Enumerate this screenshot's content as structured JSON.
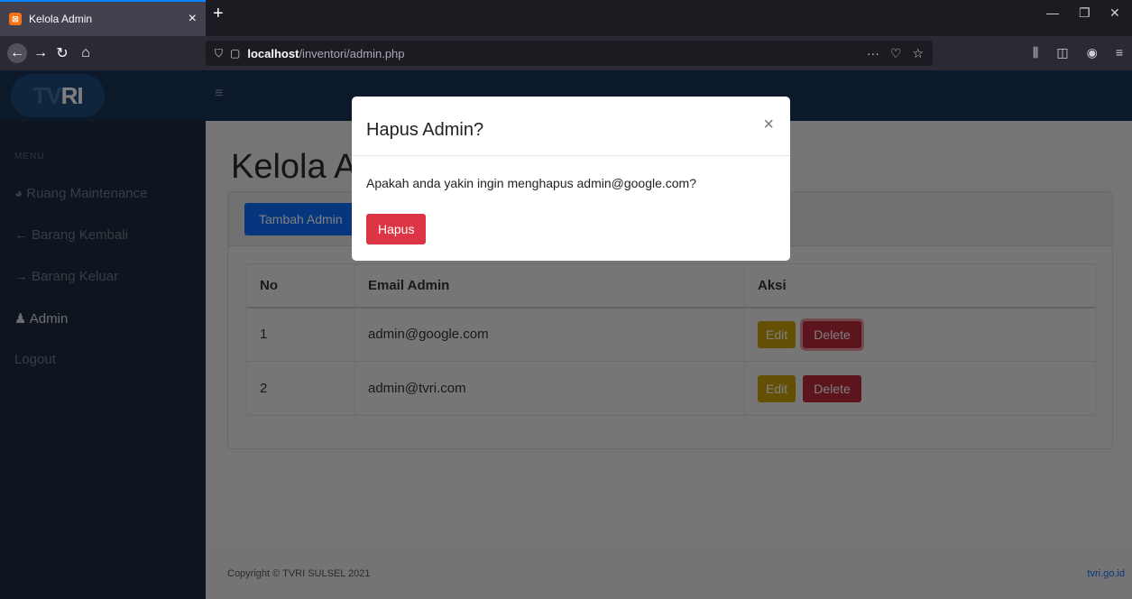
{
  "browser": {
    "tab_title": "Kelola Admin",
    "url_host": "localhost",
    "url_path": "/inventori/admin.php",
    "accent": "#0a84ff"
  },
  "header": {
    "logo_tv": "TV",
    "logo_ri": "RI"
  },
  "sidebar": {
    "heading": "MENU",
    "items": [
      {
        "label": "Ruang Maintenance",
        "icon": "gauge-icon"
      },
      {
        "label": "Barang Kembali",
        "icon": "arrow-left-icon"
      },
      {
        "label": "Barang Keluar",
        "icon": "arrow-right-icon"
      },
      {
        "label": "Admin",
        "icon": "user-icon"
      },
      {
        "label": "Logout",
        "icon": ""
      }
    ]
  },
  "main": {
    "title": "Kelola Admin",
    "add_button": "Tambah Admin",
    "table": {
      "headers": [
        "No",
        "Email Admin",
        "Aksi"
      ],
      "rows": [
        {
          "no": "1",
          "email": "admin@google.com",
          "edit": "Edit",
          "delete": "Delete"
        },
        {
          "no": "2",
          "email": "admin@tvri.com",
          "edit": "Edit",
          "delete": "Delete"
        }
      ]
    }
  },
  "footer": {
    "copyright": "Copyright © TVRI SULSEL 2021",
    "link": "tvri.go.id"
  },
  "modal": {
    "title": "Hapus Admin?",
    "message": "Apakah anda yakin ingin menghapus admin@google.com?",
    "confirm": "Hapus",
    "close": "×"
  },
  "colors": {
    "primary": "#0d6efd",
    "danger": "#dc3545",
    "warning": "#c8a10b",
    "topbar": "#163355",
    "sidebar": "#1d2b3d"
  }
}
